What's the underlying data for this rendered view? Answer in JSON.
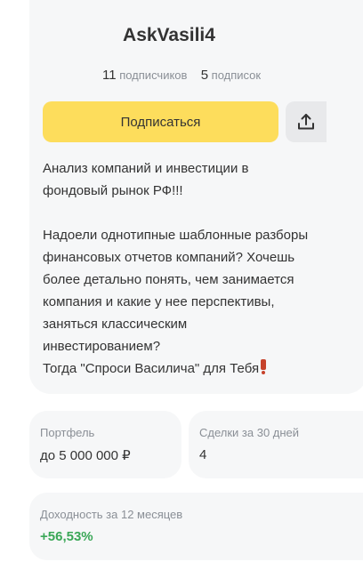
{
  "profile": {
    "username": "AskVasili4",
    "followers_count": "11",
    "followers_label": "подписчиков",
    "following_count": "5",
    "following_label": "подписок",
    "subscribe_label": "Подписаться",
    "share_icon": "share-upload-icon",
    "bio": "Анализ компаний и инвестиции в\nфондовый рынок РФ!!!\n\nНадоели однотипные шаблонные разборы\nфинансовых отчетов компаний? Хочешь\nболее детально понять, чем занимается\nкомпания и какие у нее перспективы,\nзаняться классическим\nинвестированием?\nТогда \"Спроси Василича\" для Тебя",
    "bio_emoji": "exclamation-mark-emoji"
  },
  "stats": {
    "portfolio_label": "Портфель",
    "portfolio_value": "до 5 000 000 ₽",
    "deals_label": "Сделки за 30 дней",
    "deals_value": "4",
    "yield_label": "Доходность за 12 месяцев",
    "yield_value": "+56,53%"
  },
  "colors": {
    "accent": "#fddd5c",
    "card_bg": "#f6f7f8",
    "positive": "#3aa757",
    "muted": "#8a8f96"
  }
}
